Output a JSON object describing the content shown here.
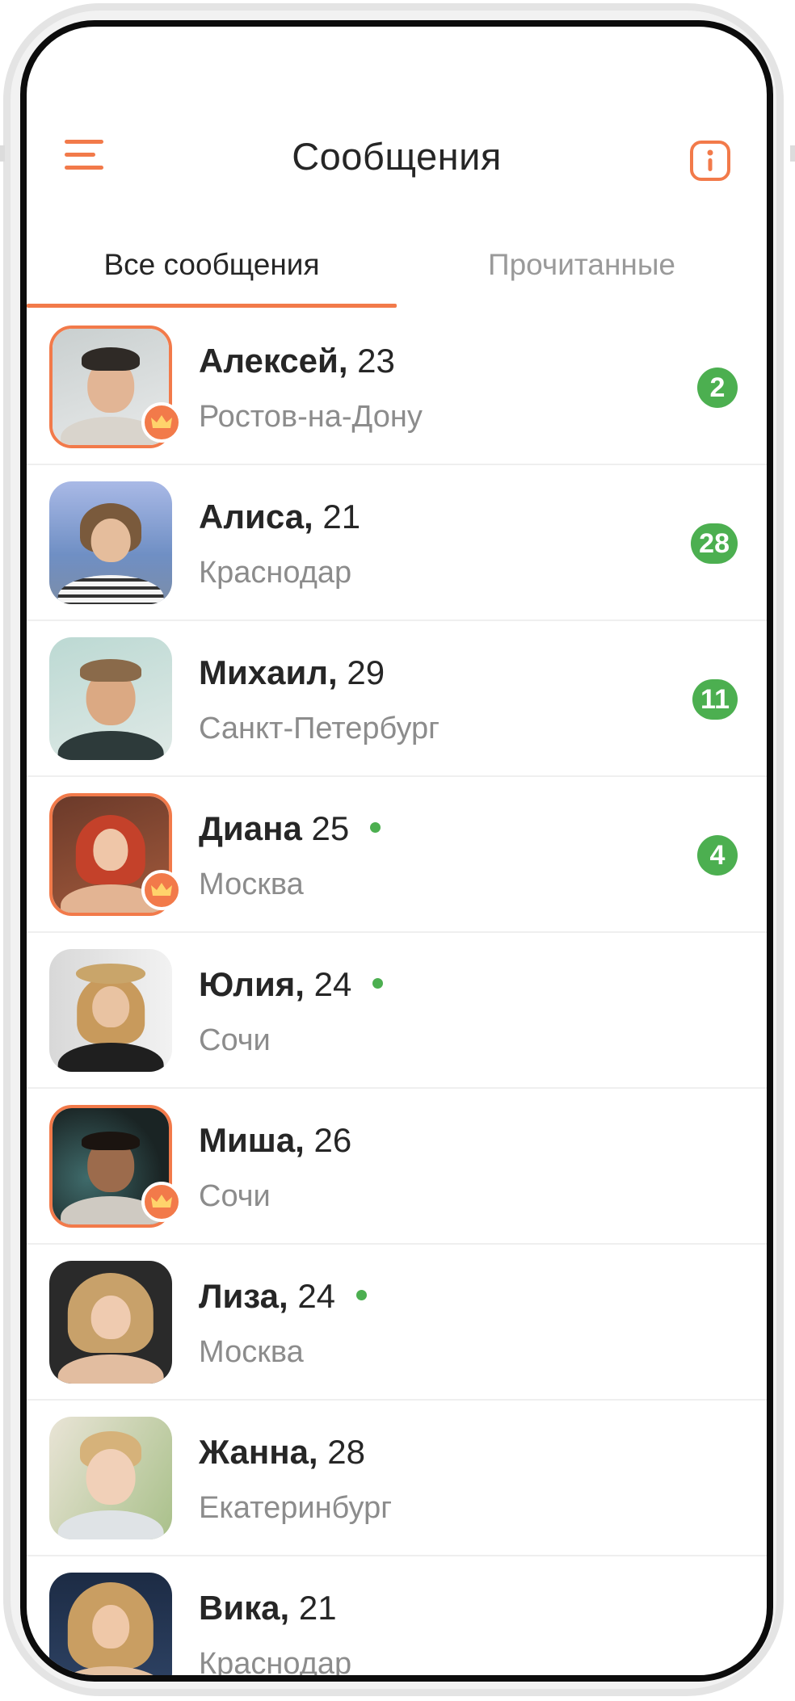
{
  "header": {
    "title": "Сообщения",
    "menu_icon": "hamburger-menu-icon",
    "info_icon": "info-icon"
  },
  "tabs": [
    {
      "label": "Все сообщения",
      "active": true
    },
    {
      "label": "Прочитанные",
      "active": false
    }
  ],
  "colors": {
    "accent": "#f27a4a",
    "online": "#4caf50",
    "badge": "#4caf50"
  },
  "conversations": [
    {
      "name": "Алексей,",
      "age": "23",
      "city": "Ростов-на-Дону",
      "unread": "2",
      "online": false,
      "premium": true
    },
    {
      "name": "Алиса,",
      "age": "21",
      "city": "Краснодар",
      "unread": "28",
      "online": false,
      "premium": false
    },
    {
      "name": "Михаил,",
      "age": "29",
      "city": "Санкт-Петербург",
      "unread": "11",
      "online": false,
      "premium": false
    },
    {
      "name": "Диана",
      "age": "25",
      "city": "Москва",
      "unread": "4",
      "online": true,
      "premium": true
    },
    {
      "name": "Юлия,",
      "age": "24",
      "city": "Сочи",
      "unread": "",
      "online": true,
      "premium": false
    },
    {
      "name": "Миша,",
      "age": "26",
      "city": "Сочи",
      "unread": "",
      "online": false,
      "premium": true
    },
    {
      "name": "Лиза,",
      "age": "24",
      "city": "Москва",
      "unread": "",
      "online": true,
      "premium": false
    },
    {
      "name": "Жанна,",
      "age": "28",
      "city": "Екатеринбург",
      "unread": "",
      "online": false,
      "premium": false
    },
    {
      "name": "Вика,",
      "age": "21",
      "city": "Краснодар",
      "unread": "",
      "online": false,
      "premium": false
    }
  ]
}
